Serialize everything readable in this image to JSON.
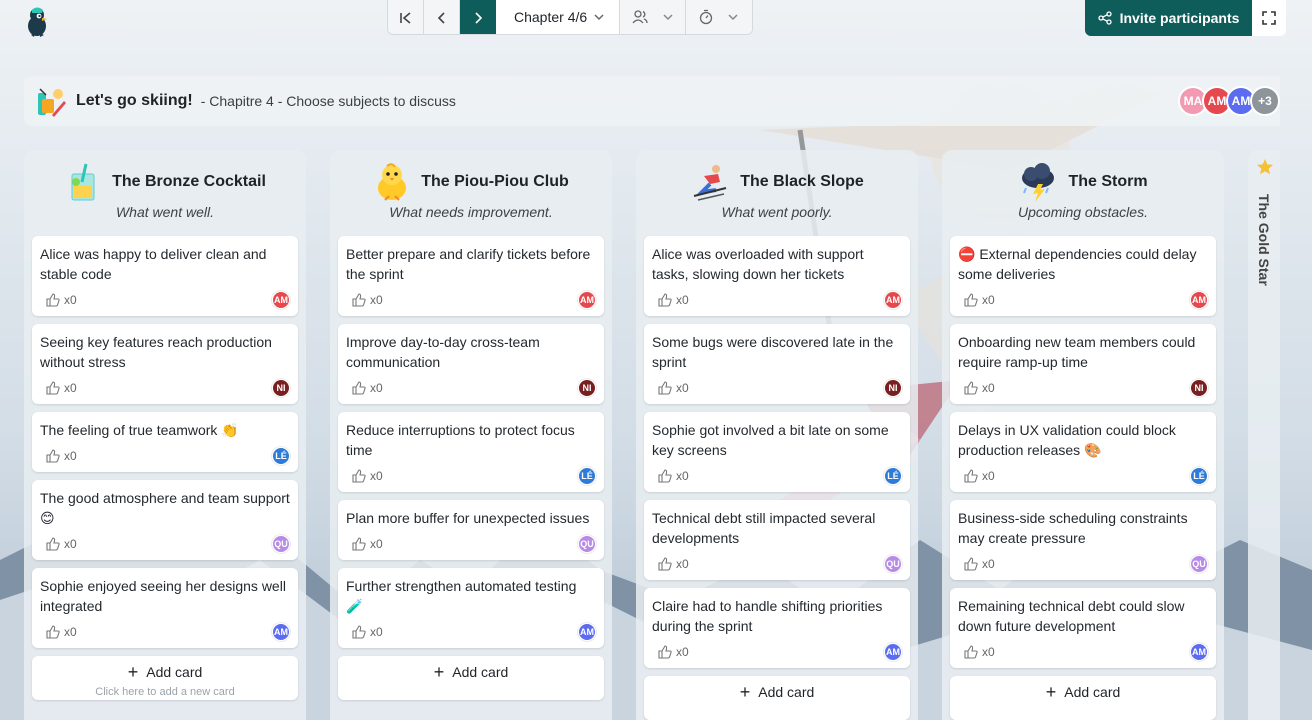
{
  "nav": {
    "chapter_label": "Chapter 4/6"
  },
  "header": {
    "invite_label": "Invite participants"
  },
  "session": {
    "title": "Let's go skiing!",
    "subtitle": "- Chapitre 4 - Choose subjects to discuss"
  },
  "participants": [
    {
      "initials": "MA",
      "color": "#f29ab2"
    },
    {
      "initials": "AM",
      "color": "#e5484d"
    },
    {
      "initials": "AM",
      "color": "#5b6cf0"
    },
    {
      "initials": "+3",
      "color": "#8d949a"
    }
  ],
  "columns": [
    {
      "title": "The Bronze Cocktail",
      "subtitle": "What went well.",
      "icon": "cocktail-icon",
      "cards": [
        {
          "text": "Alice was happy to deliver clean and stable code",
          "likes": "x0",
          "author": "AM",
          "author_color": "#e5484d"
        },
        {
          "text": "Seeing key features reach production without stress",
          "likes": "x0",
          "author": "NI",
          "author_color": "#7a1f1f"
        },
        {
          "text": "The feeling of true teamwork 👏",
          "likes": "x0",
          "author": "LÉ",
          "author_color": "#2f7bd8"
        },
        {
          "text": "The good atmosphere and team support 😊",
          "likes": "x0",
          "author": "QU",
          "author_color": "#b78be6"
        },
        {
          "text": "Sophie enjoyed seeing her designs well integrated",
          "likes": "x0",
          "author": "AM",
          "author_color": "#5b6cf0"
        }
      ],
      "add_label": "Add card",
      "add_hint": "Click here to add a new card"
    },
    {
      "title": "The Piou-Piou Club",
      "subtitle": "What needs improvement.",
      "icon": "chick-icon",
      "cards": [
        {
          "text": "Better prepare and clarify tickets before the sprint",
          "likes": "x0",
          "author": "AM",
          "author_color": "#e5484d"
        },
        {
          "text": "Improve day-to-day cross-team communication",
          "likes": "x0",
          "author": "NI",
          "author_color": "#7a1f1f"
        },
        {
          "text": "Reduce interruptions to protect focus time",
          "likes": "x0",
          "author": "LÉ",
          "author_color": "#2f7bd8"
        },
        {
          "text": "Plan more buffer for unexpected issues",
          "likes": "x0",
          "author": "QU",
          "author_color": "#b78be6"
        },
        {
          "text": "Further strengthen automated testing 🧪",
          "likes": "x0",
          "author": "AM",
          "author_color": "#5b6cf0"
        }
      ],
      "add_label": "Add card",
      "add_hint": ""
    },
    {
      "title": "The Black Slope",
      "subtitle": "What went poorly.",
      "icon": "skier-icon",
      "cards": [
        {
          "text": "Alice was overloaded with support tasks, slowing down her tickets",
          "likes": "x0",
          "author": "AM",
          "author_color": "#e5484d"
        },
        {
          "text": "Some bugs were discovered late in the sprint",
          "likes": "x0",
          "author": "NI",
          "author_color": "#7a1f1f"
        },
        {
          "text": "Sophie got involved a bit late on some key screens",
          "likes": "x0",
          "author": "LÉ",
          "author_color": "#2f7bd8"
        },
        {
          "text": "Technical debt still impacted several developments",
          "likes": "x0",
          "author": "QU",
          "author_color": "#b78be6"
        },
        {
          "text": "Claire had to handle shifting priorities during the sprint",
          "likes": "x0",
          "author": "AM",
          "author_color": "#5b6cf0"
        }
      ],
      "add_label": "Add card",
      "add_hint": ""
    },
    {
      "title": "The Storm",
      "subtitle": "Upcoming obstacles.",
      "icon": "storm-cloud-icon",
      "cards": [
        {
          "text": "⛔ External dependencies could delay some deliveries",
          "likes": "x0",
          "author": "AM",
          "author_color": "#e5484d"
        },
        {
          "text": "Onboarding new team members could require ramp-up time",
          "likes": "x0",
          "author": "NI",
          "author_color": "#7a1f1f"
        },
        {
          "text": "Delays in UX validation could block production releases 🎨",
          "likes": "x0",
          "author": "LÉ",
          "author_color": "#2f7bd8"
        },
        {
          "text": "Business-side scheduling constraints may create pressure",
          "likes": "x0",
          "author": "QU",
          "author_color": "#b78be6"
        },
        {
          "text": "Remaining technical debt could slow down future development",
          "likes": "x0",
          "author": "AM",
          "author_color": "#5b6cf0"
        }
      ],
      "add_label": "Add card",
      "add_hint": ""
    }
  ],
  "gold_column": {
    "title": "The Gold Star"
  },
  "colors": {
    "primary": "#0f5d5a"
  }
}
